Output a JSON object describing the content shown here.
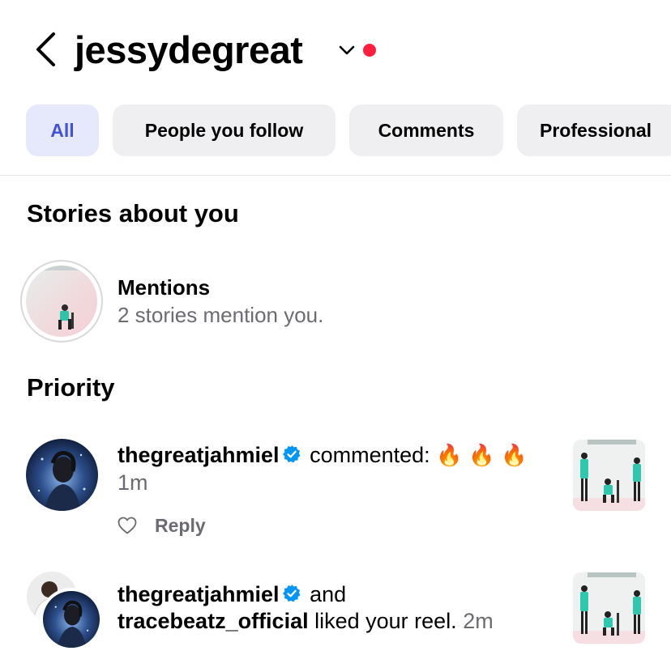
{
  "header": {
    "username": "jessydegreat"
  },
  "tabs": [
    {
      "label": "All",
      "active": true
    },
    {
      "label": "People you follow",
      "active": false
    },
    {
      "label": "Comments",
      "active": false
    },
    {
      "label": "Professional",
      "active": false
    }
  ],
  "stories_section": {
    "title": "Stories about you",
    "mentions": {
      "title": "Mentions",
      "subtitle": "2 stories mention you."
    }
  },
  "priority_section": {
    "title": "Priority",
    "notifications": [
      {
        "user": "thegreatjahmiel",
        "action": "commented:",
        "emoji": "🔥",
        "time": "1m",
        "reply_label": "Reply"
      },
      {
        "user": "thegreatjahmiel",
        "connector": "and",
        "user2": "tracebeatz_official",
        "action": "liked your reel.",
        "time": "2m"
      }
    ]
  },
  "colors": {
    "accent": "#4151d9",
    "active_tab_bg": "#e6e9fb",
    "tab_bg": "#efeff1",
    "notification_dot": "#ff1f3d",
    "verified_badge": "#0095f6",
    "secondary_text": "#6b6b72"
  },
  "icons": [
    "back-arrow-icon",
    "chevron-down-icon",
    "verified-badge-icon",
    "heart-icon",
    "fire-emoji"
  ]
}
